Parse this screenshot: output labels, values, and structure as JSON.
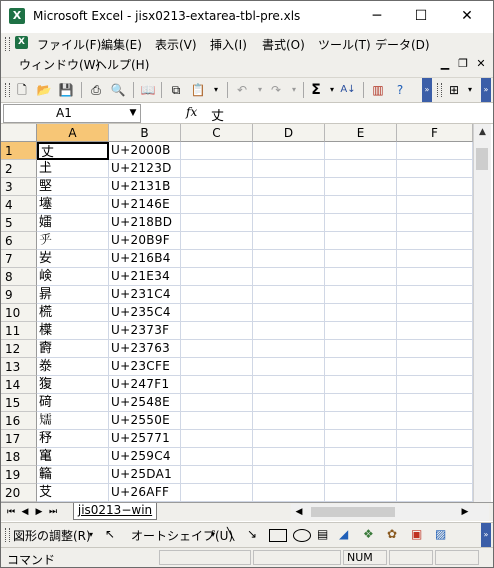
{
  "window": {
    "title": "Microsoft Excel - jisx0213-extarea-tbl-pre.xls",
    "minimize_glyph": "─",
    "maximize_glyph": "☐",
    "close_glyph": "✕"
  },
  "menu": {
    "items": [
      "ファイル(F)",
      "編集(E)",
      "表示(V)",
      "挿入(I)",
      "書式(O)",
      "ツール(T)",
      "データ(D)",
      "ウィンドウ(W)",
      "ヘルプ(H)"
    ]
  },
  "formula_bar": {
    "name_box": "A1",
    "fx_label": "fx",
    "value": "丈"
  },
  "columns": [
    "A",
    "B",
    "C",
    "D",
    "E",
    "F"
  ],
  "rows": [
    {
      "n": "1",
      "a": "丈",
      "b": "U+2000B"
    },
    {
      "n": "2",
      "a": "𡈽",
      "b": "U+2123D"
    },
    {
      "n": "3",
      "a": "𡌛",
      "b": "U+2131B"
    },
    {
      "n": "4",
      "a": "𡑮",
      "b": "U+2146E"
    },
    {
      "n": "5",
      "a": "𡢽",
      "b": "U+218BD"
    },
    {
      "n": "6",
      "a": "𠂟",
      "b": "U+20B9F"
    },
    {
      "n": "7",
      "a": "𡚴",
      "b": "U+216B4"
    },
    {
      "n": "8",
      "a": "𡸴",
      "b": "U+21E34"
    },
    {
      "n": "9",
      "a": "𣇄",
      "b": "U+231C4"
    },
    {
      "n": "10",
      "a": "𣗄",
      "b": "U+235C4"
    },
    {
      "n": "11",
      "a": "𣜿",
      "b": "U+2373F"
    },
    {
      "n": "12",
      "a": "𣝣",
      "b": "U+23763"
    },
    {
      "n": "13",
      "a": "𣳾",
      "b": "U+23CFE"
    },
    {
      "n": "14",
      "a": "𤟱",
      "b": "U+247F1"
    },
    {
      "n": "15",
      "a": "𥔎",
      "b": "U+2548E"
    },
    {
      "n": "16",
      "a": "𥐎",
      "b": "U+2550E"
    },
    {
      "n": "17",
      "a": "𥝱",
      "b": "U+25771"
    },
    {
      "n": "18",
      "a": "𥧄",
      "b": "U+259C4"
    },
    {
      "n": "19",
      "a": "𥶡",
      "b": "U+25DA1"
    },
    {
      "n": "20",
      "a": "𦫿",
      "b": "U+26AFF"
    }
  ],
  "sheet_tab": "jis0213−win",
  "draw_toolbar": {
    "adjust_label": "図形の調整(R)",
    "autoshape_label": "オートシェイプ(U)"
  },
  "status": {
    "text": "コマンド",
    "num": "NUM"
  }
}
